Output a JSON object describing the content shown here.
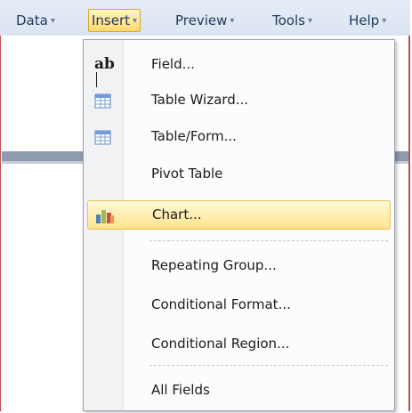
{
  "menubar": {
    "items": [
      {
        "label": "Data"
      },
      {
        "label": "Insert"
      },
      {
        "label": "Preview"
      },
      {
        "label": "Tools"
      },
      {
        "label": "Help"
      }
    ],
    "dropdown_glyph": "▾",
    "active_item": "Insert"
  },
  "insert_menu": {
    "items": [
      {
        "label": "Field...",
        "icon": "field-ab-icon"
      },
      {
        "label": "Table Wizard...",
        "icon": "table-icon"
      },
      {
        "label": "Table/Form...",
        "icon": "table-icon"
      },
      {
        "label": "Pivot Table",
        "icon": ""
      },
      {
        "label": "Chart...",
        "icon": "bar-chart-icon",
        "highlighted": true
      },
      {
        "label": "Repeating Group...",
        "icon": ""
      },
      {
        "label": "Conditional Format...",
        "icon": ""
      },
      {
        "label": "Conditional Region...",
        "icon": ""
      },
      {
        "label": "All Fields",
        "icon": ""
      }
    ]
  },
  "icons": {
    "field_glyph": "ab"
  },
  "colors": {
    "highlight_top": "#fff8d8",
    "highlight_bottom": "#ffe38c",
    "frame_border": "#c0504d",
    "menubar_text": "#1e395b"
  }
}
